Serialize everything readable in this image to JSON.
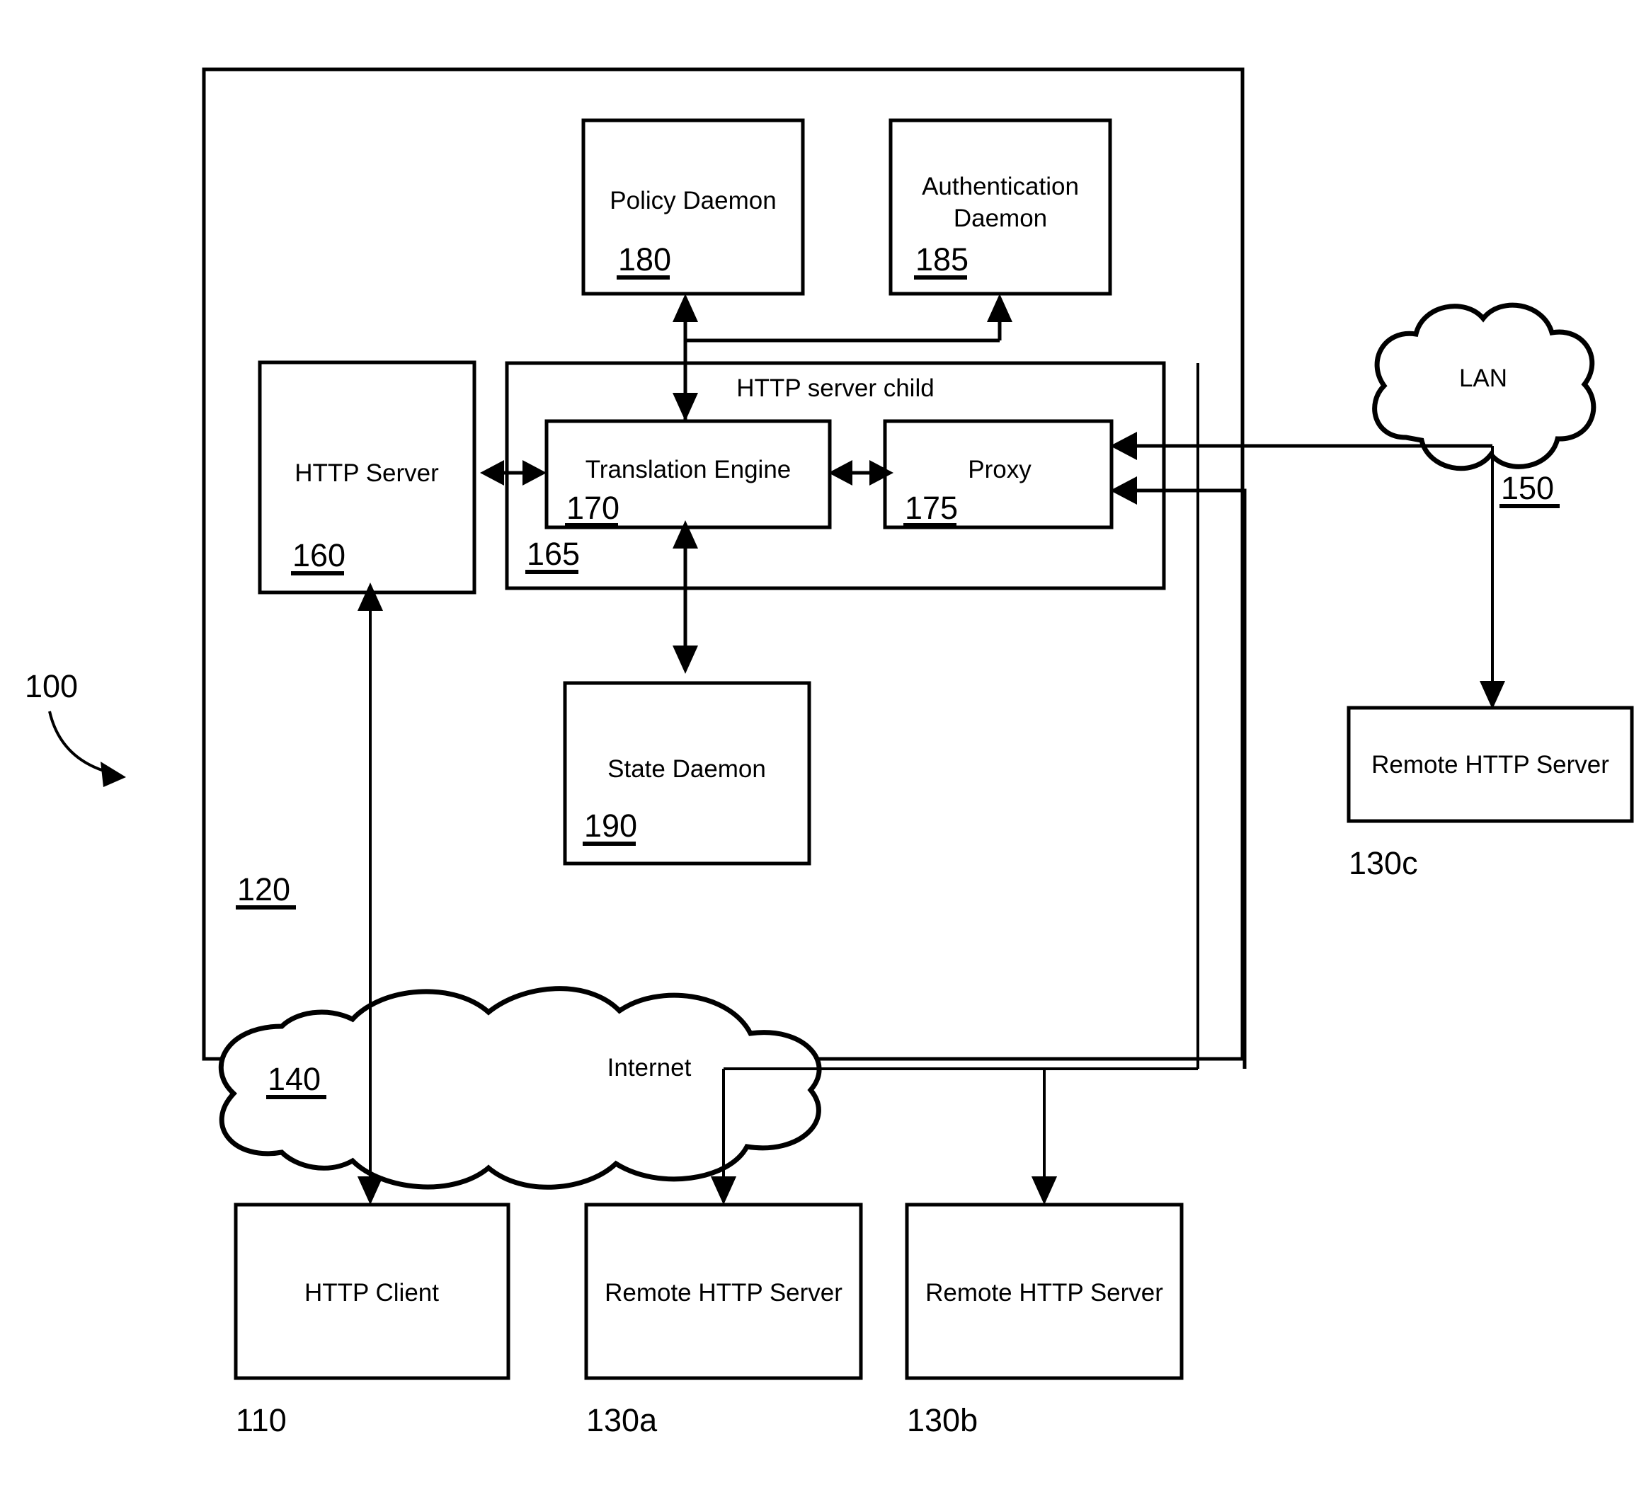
{
  "figure": {
    "system_ref": "100",
    "outer_container_ref": "120"
  },
  "boxes": {
    "policy_daemon": {
      "label": "Policy Daemon",
      "ref": "180"
    },
    "authentication_daemon": {
      "label_line1": "Authentication",
      "label_line2": "Daemon",
      "ref": "185"
    },
    "http_server": {
      "label": "HTTP Server",
      "ref": "160"
    },
    "http_server_child": {
      "label": "HTTP server child",
      "ref": "165"
    },
    "translation_engine": {
      "label": "Translation Engine",
      "ref": "170"
    },
    "proxy": {
      "label": "Proxy",
      "ref": "175"
    },
    "state_daemon": {
      "label": "State Daemon",
      "ref": "190"
    },
    "remote_http_server_c": {
      "label": "Remote HTTP Server",
      "ref": "130c"
    },
    "http_client": {
      "label": "HTTP Client",
      "ref": "110"
    },
    "remote_http_server_a": {
      "label": "Remote HTTP Server",
      "ref": "130a"
    },
    "remote_http_server_b": {
      "label": "Remote HTTP Server",
      "ref": "130b"
    }
  },
  "clouds": {
    "lan": {
      "label": "LAN",
      "ref": "150"
    },
    "internet": {
      "label": "Internet",
      "ref": "140"
    }
  },
  "colors": {
    "stroke": "#000000",
    "background": "#ffffff"
  }
}
